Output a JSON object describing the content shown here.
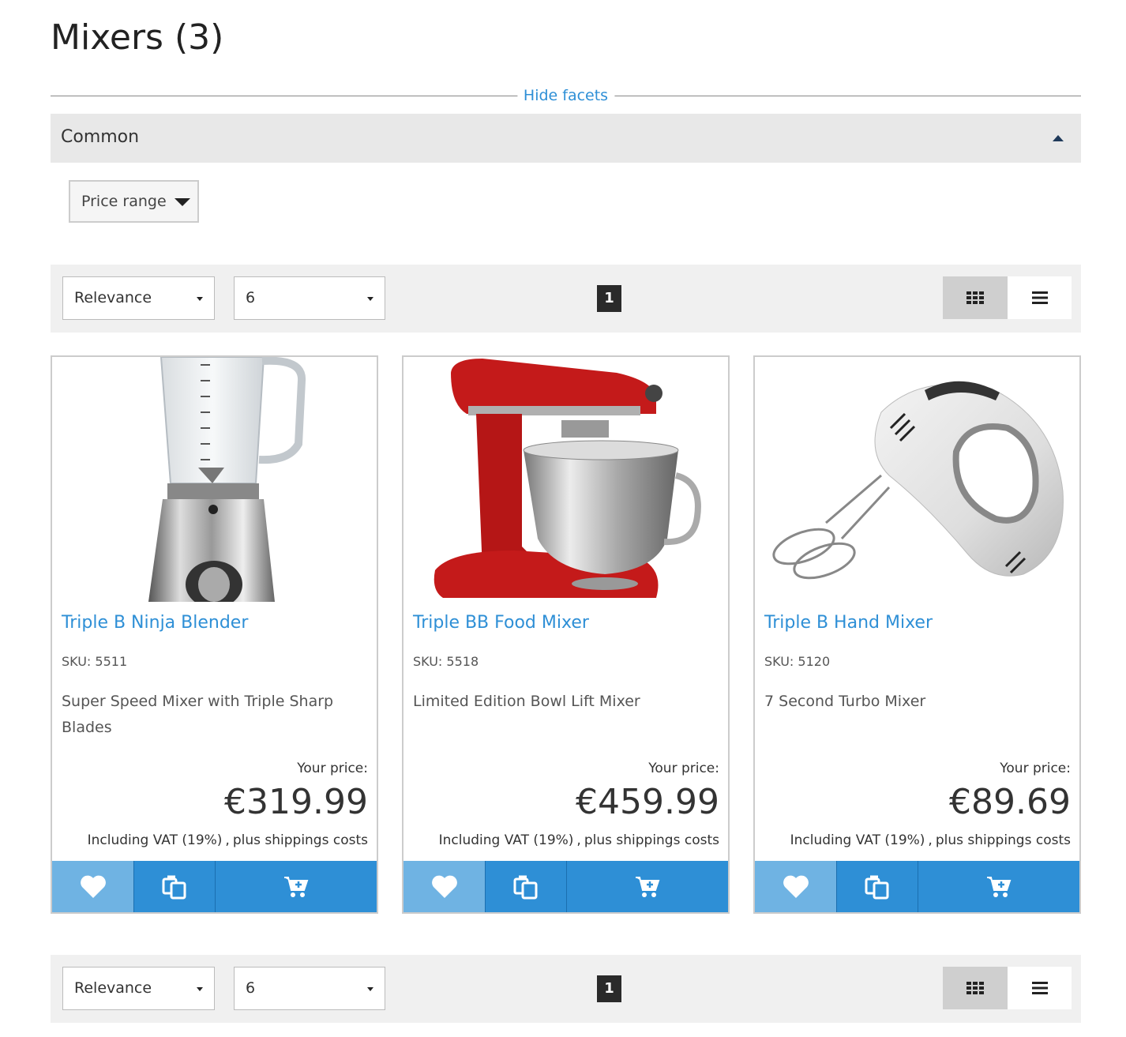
{
  "page": {
    "title": "Mixers",
    "count": "(3)"
  },
  "facets": {
    "toggle_label": "Hide facets",
    "group_title": "Common",
    "price_range_label": "Price range"
  },
  "toolbar": {
    "sort_value": "Relevance",
    "per_page_value": "6",
    "page_number": "1"
  },
  "products": [
    {
      "name": "Triple B Ninja Blender",
      "sku": "SKU: 5511",
      "description": "Super Speed Mixer with Triple Sharp Blades",
      "price_label": "Your price:",
      "price": "€319.99",
      "vat": "Including VAT (19%)",
      "shipping": "plus shippings costs"
    },
    {
      "name": "Triple BB Food Mixer",
      "sku": "SKU: 5518",
      "description": "Limited Edition Bowl Lift Mixer",
      "price_label": "Your price:",
      "price": "€459.99",
      "vat": "Including VAT (19%)",
      "shipping": "plus shippings costs"
    },
    {
      "name": "Triple B Hand Mixer",
      "sku": "SKU: 5120",
      "description": "7 Second Turbo Mixer",
      "price_label": "Your price:",
      "price": "€89.69",
      "vat": "Including VAT (19%)",
      "shipping": "plus shippings costs"
    }
  ],
  "icons": {
    "wishlist": "heart-icon",
    "compare": "compare-icon",
    "cart": "cart-add-icon",
    "grid_view": "grid-view-icon",
    "list_view": "list-view-icon"
  },
  "colors": {
    "accent": "#2e8fd6",
    "accent_light": "#6fb3e3",
    "toolbar_bg": "#f0f0f0",
    "facet_bg": "#e8e8e8",
    "mixer_red": "#c41a1a"
  }
}
